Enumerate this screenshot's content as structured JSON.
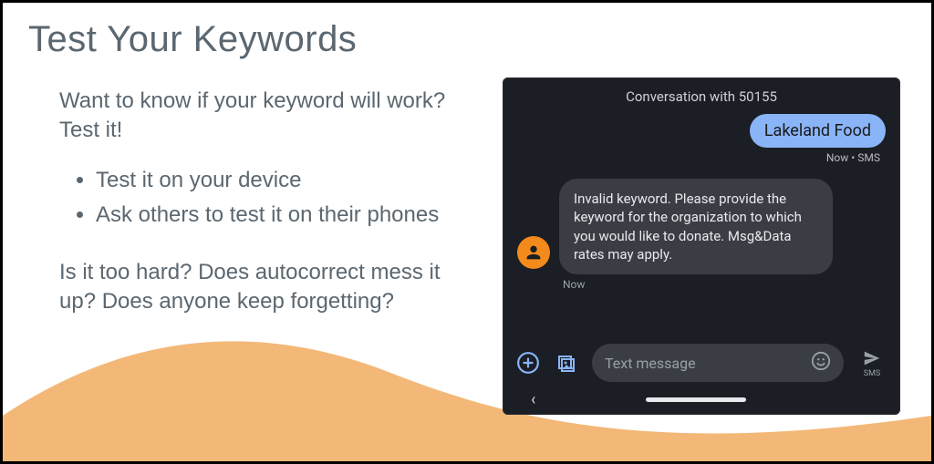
{
  "title": "Test Your Keywords",
  "intro": "Want to know if your keyword will work? Test it!",
  "bullets": [
    "Test it on your device",
    "Ask others to test it on their phones"
  ],
  "closing": "Is it too hard? Does autocorrect mess it up? Does anyone keep forgetting?",
  "phone": {
    "header": "Conversation with 50155",
    "sent": {
      "text": "Lakeland Food",
      "meta": "Now • SMS"
    },
    "received": {
      "text": "Invalid keyword. Please provide the keyword for the organization to which you would like to donate. Msg&Data rates may apply.",
      "meta": "Now"
    },
    "compose": {
      "placeholder": "Text message",
      "sendLabel": "SMS"
    }
  }
}
